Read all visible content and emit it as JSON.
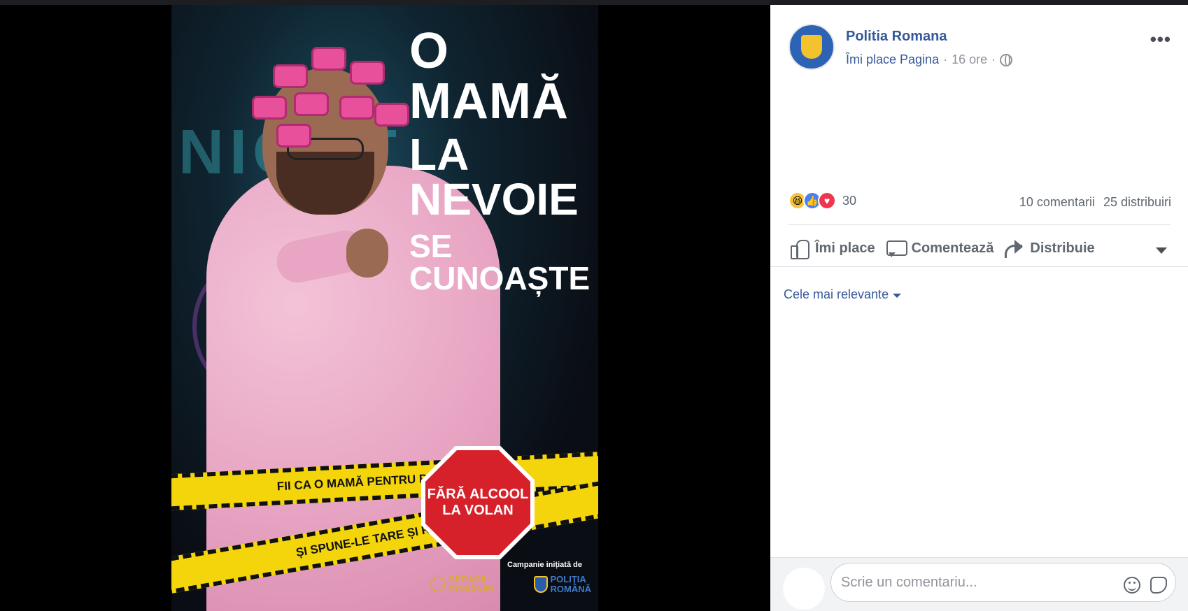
{
  "poster": {
    "headline_line1": "O MAMĂ",
    "headline_line2": "LA NEVOIE",
    "headline_line3": "SE CUNOAȘTE",
    "tape_top": "FII CA O MAMĂ PENTRU PRIETENII TĂI",
    "tape_bottom": "ȘI SPUNE-LE TARE ȘI RĂSPICAT",
    "stop_line1": "FĂRĂ ALCOOL",
    "stop_line2": "LA VOLAN",
    "campaign": "Campanie inițiată de",
    "logo_left_line1": "BERARII",
    "logo_left_line2": "ROMÂNIEI",
    "logo_right_line1": "POLIȚIA",
    "logo_right_line2": "ROMÂNĂ",
    "neon_text": "NIGHT"
  },
  "post": {
    "page_name": "Politia Romana",
    "like_page": "Îmi place Pagina",
    "separator": "·",
    "time": "16 ore",
    "more_icon": "•••",
    "reaction_count": "30",
    "comments": "10 comentarii",
    "shares": "25 distribuiri",
    "like_label": "Îmi place",
    "comment_label": "Comentează",
    "share_label": "Distribuie",
    "sort_label": "Cele mai relevante",
    "composer_placeholder": "Scrie un comentariu..."
  },
  "colors": {
    "link_blue": "#365899",
    "gray_text": "#606770",
    "tape_yellow": "#f4d50b",
    "stop_red": "#d6212b"
  },
  "icons": [
    "globe-icon",
    "more-icon",
    "like-icon",
    "comment-icon",
    "share-icon",
    "emoji-icon",
    "sticker-icon",
    "haha-reaction-icon",
    "like-reaction-icon",
    "love-reaction-icon"
  ]
}
